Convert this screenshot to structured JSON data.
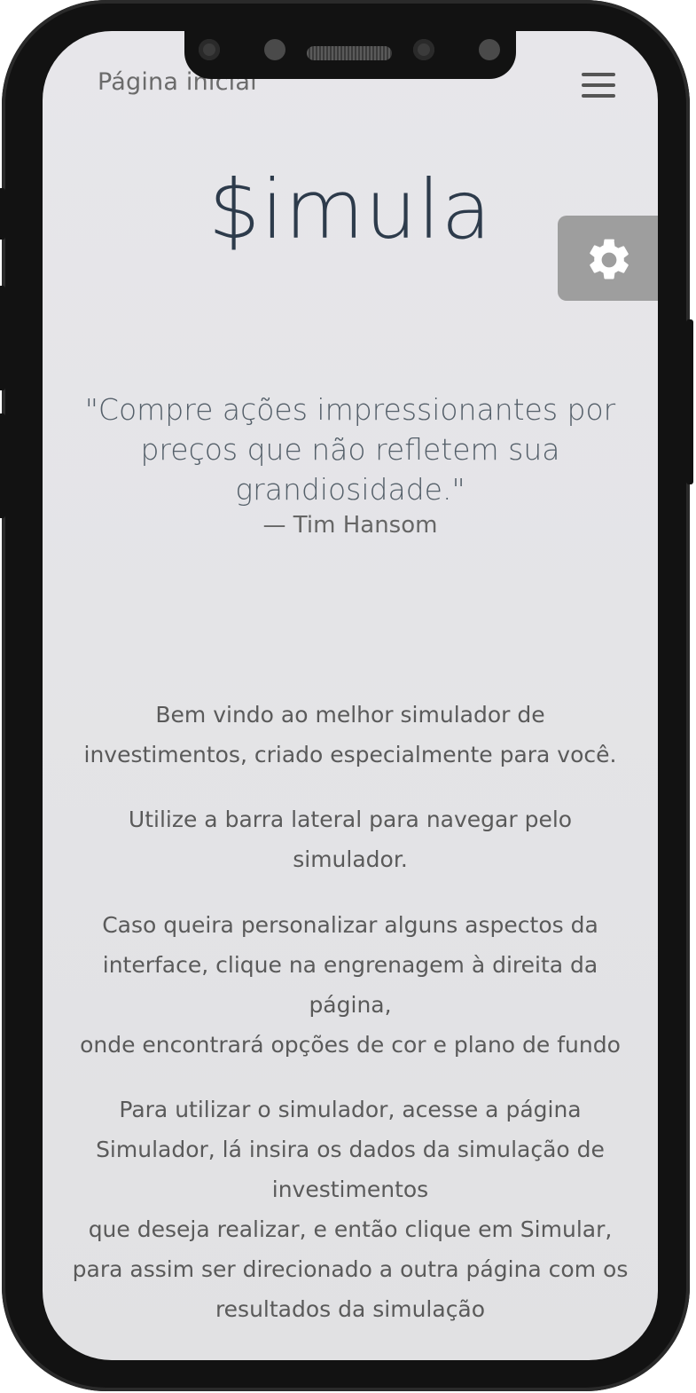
{
  "header": {
    "title": "Página inicial",
    "menu_icon": "hamburger-menu-icon"
  },
  "brand": {
    "name": "$imula"
  },
  "settings": {
    "icon": "gear-icon",
    "color": "#9e9e9e"
  },
  "quote": {
    "text": "\"Compre ações impressionantes por preços que não refletem sua grandiosidade.\"",
    "author": "— Tim Hansom"
  },
  "content": {
    "paragraphs": [
      "Bem vindo ao melhor simulador de investimentos, criado especialmente para você.",
      "Utilize a barra lateral para navegar pelo simulador.",
      "Caso queira personalizar alguns aspectos da interface, clique na engrenagem à direita da página,\nonde encontrará opções de cor e plano de fundo",
      "Para utilizar o simulador, acesse a página Simulador, lá insira os dados da simulação de investimentos\nque deseja realizar, e então clique em Simular, para assim ser direcionado a outra página com os resultados da simulação"
    ]
  },
  "colors": {
    "brand": "#2d3b4b",
    "background": "#e4e4e7"
  }
}
